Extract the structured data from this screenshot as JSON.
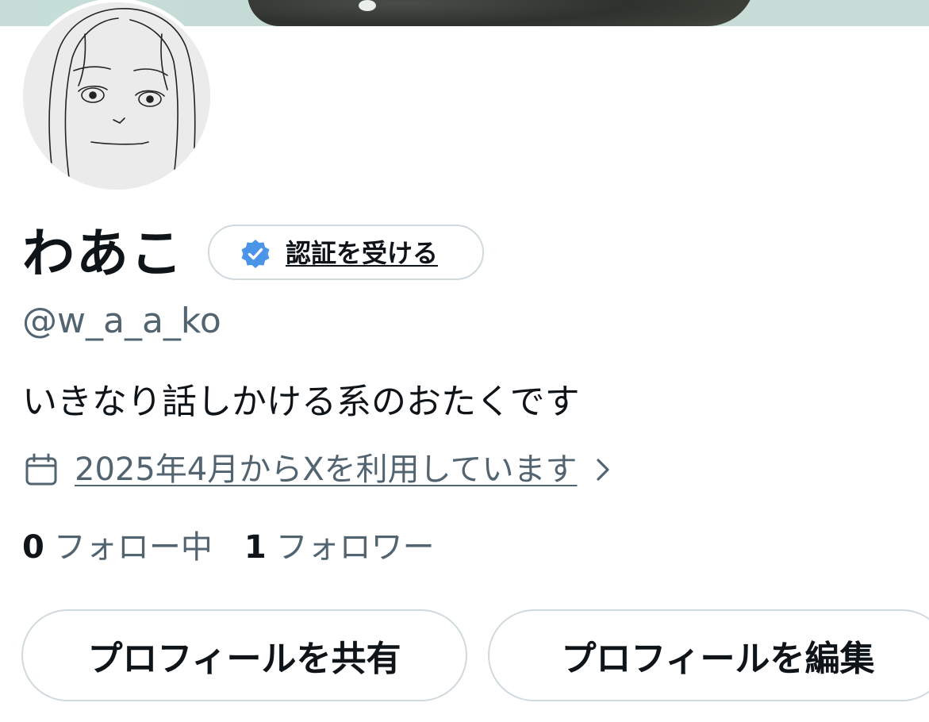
{
  "profile": {
    "display_name": "わあこ",
    "handle": "@w_a_a_ko",
    "bio": "いきなり話しかける系のおたくです",
    "joined": "2025年4月からXを利用しています"
  },
  "verify": {
    "label": "認証を受ける"
  },
  "stats": {
    "following_count": "0",
    "following_label": "フォロー中",
    "followers_count": "1",
    "followers_label": "フォロワー"
  },
  "buttons": {
    "share": "プロフィールを共有",
    "edit": "プロフィールを編集"
  },
  "icons": {
    "verified": "verified-badge-icon",
    "calendar": "calendar-icon",
    "chevron": "chevron-right-icon"
  },
  "colors": {
    "text_primary": "#0f1419",
    "text_secondary": "#536471",
    "border": "#cfd9de",
    "verified_blue": "#4b95e9"
  }
}
